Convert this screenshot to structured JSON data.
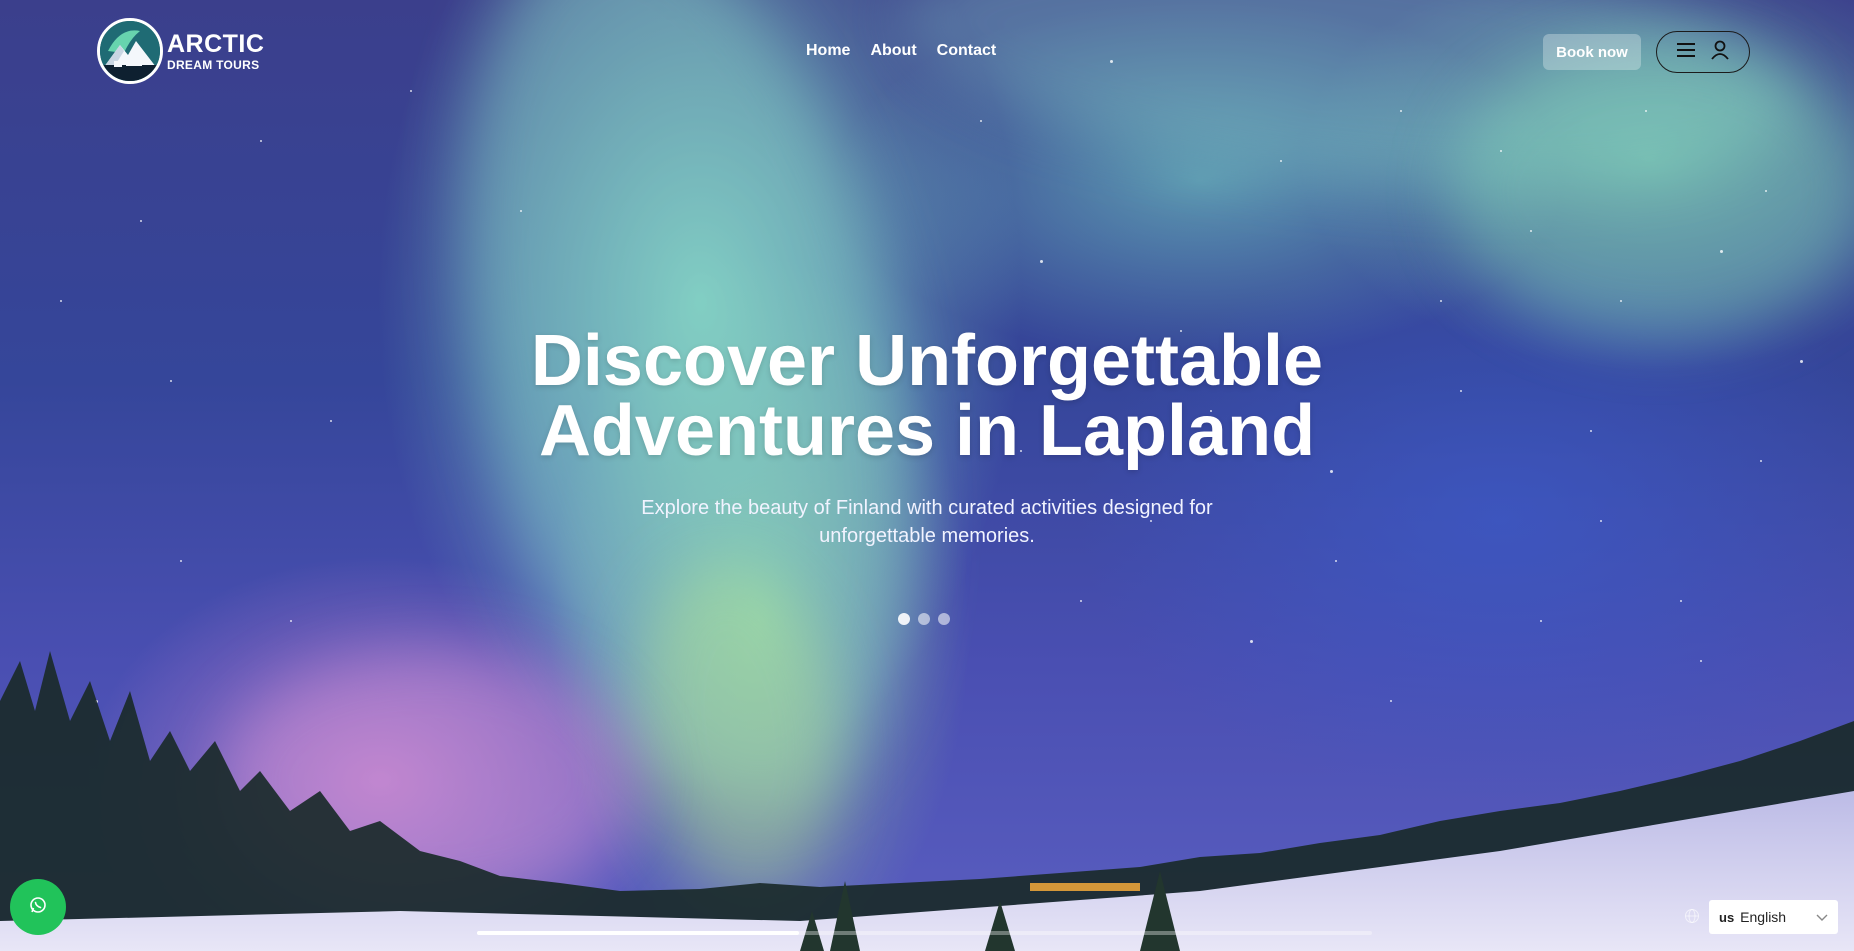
{
  "brand": {
    "title": "ARCTIC",
    "subtitle": "DREAM TOURS"
  },
  "nav": {
    "items": [
      {
        "label": "Home"
      },
      {
        "label": "About"
      },
      {
        "label": "Contact"
      }
    ]
  },
  "header": {
    "book_label": "Book now",
    "menu_icon": "hamburger-icon",
    "account_icon": "user-icon"
  },
  "hero": {
    "title_line1": "Discover Unforgettable",
    "title_line2": "Adventures in Lapland",
    "subtitle_line1": "Explore the beauty of Finland with curated activities designed for",
    "subtitle_line2": "unforgettable memories.",
    "slide_count": 3,
    "active_slide": 1,
    "slide_progress": 0.36
  },
  "widgets": {
    "whatsapp_icon": "whatsapp-icon",
    "language": {
      "code": "us",
      "label": "English",
      "icon": "globe-icon"
    }
  },
  "colors": {
    "whatsapp": "#21c35a",
    "sky": "#35469a",
    "aurora": "#8ce6c8"
  }
}
